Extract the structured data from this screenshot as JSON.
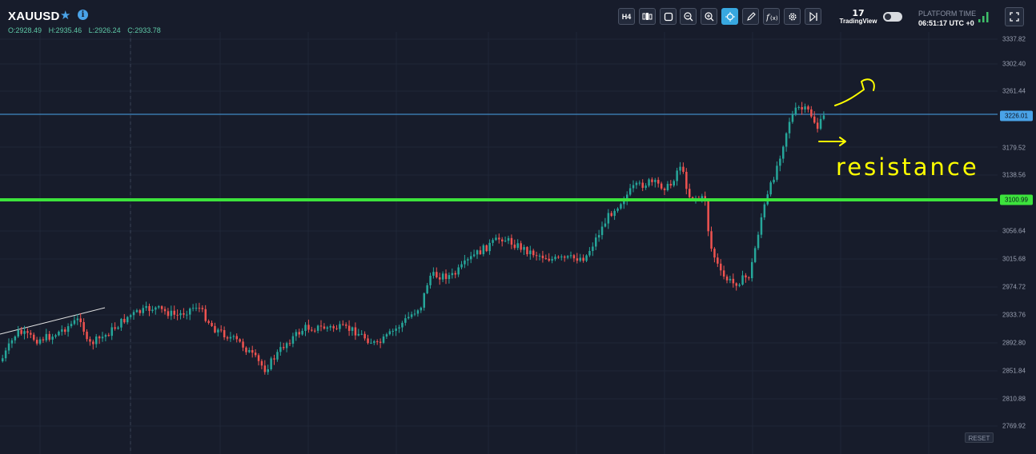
{
  "header": {
    "symbol": "XAUUSD",
    "star_icon": "star-icon",
    "info_icon": "info-icon",
    "ohlc": {
      "open": "O:2928.49",
      "high": "H:2935.46",
      "low": "L:2926.24",
      "close": "C:2933.78"
    }
  },
  "toolbar": {
    "timeframe_label": "H4",
    "buttons": [
      "timeframe",
      "candles-type",
      "drawing-shape",
      "zoom-out",
      "zoom-in",
      "crosshair",
      "pencil",
      "indicators",
      "settings",
      "replay"
    ]
  },
  "platform": {
    "logo_mark": "17",
    "logo_text": "TradingView",
    "time_label": "PLATFORM TIME",
    "time_value": "06:51:17 UTC +0"
  },
  "price_axis": {
    "ticks": [
      "3337.82",
      "3302.40",
      "3261.44",
      "3179.52",
      "3138.56",
      "3056.64",
      "3015.68",
      "2974.72",
      "2933.76",
      "2892.80",
      "2851.84",
      "2810.88",
      "2769.92"
    ],
    "current_price": "3226.01",
    "support_price": "3100.99"
  },
  "annotation": {
    "text": "resistance"
  },
  "reset_label": "RESET",
  "colors": {
    "background": "#171c2b",
    "up_candle": "#26a69a",
    "down_candle": "#ef5350",
    "support_line": "#3ce33c",
    "price_line": "#4aa3e8",
    "annotation": "#ffff00"
  }
}
